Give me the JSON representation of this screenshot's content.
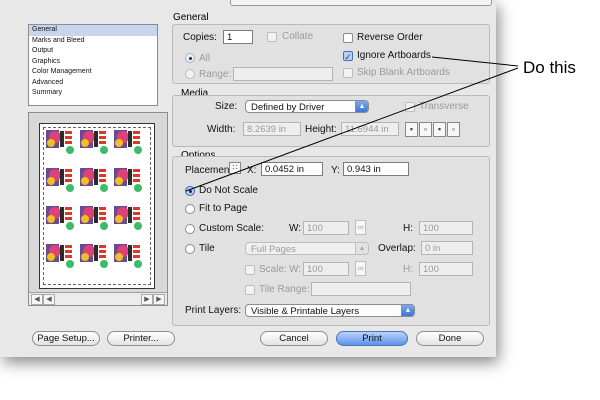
{
  "sidebar": {
    "items": [
      {
        "label": "General",
        "selected": true
      },
      {
        "label": "Marks and Bleed"
      },
      {
        "label": "Output"
      },
      {
        "label": "Graphics"
      },
      {
        "label": "Color Management"
      },
      {
        "label": "Advanced"
      },
      {
        "label": "Summary"
      }
    ]
  },
  "top_label_fragment": "",
  "general": {
    "title": "General",
    "copies_label": "Copies:",
    "copies_value": "1",
    "collate_label": "Collate",
    "all_label": "All",
    "range_label": "Range:",
    "reverse_order_label": "Reverse Order",
    "ignore_artboards_label": "Ignore Artboards",
    "skip_blank_label": "Skip Blank Artboards"
  },
  "media": {
    "title": "Media",
    "size_label": "Size:",
    "size_value": "Defined by Driver",
    "transverse_label": "Transverse",
    "width_label": "Width:",
    "width_value": "8.2639 in",
    "height_label": "Height:",
    "height_value": "11.6944 in"
  },
  "options": {
    "title": "Options",
    "placement_label": "Placement:",
    "x_label": "X:",
    "x_value": "0.0452 in",
    "y_label": "Y:",
    "y_value": "0.943 in",
    "do_not_scale": "Do Not Scale",
    "fit_to_page": "Fit to Page",
    "custom_scale": "Custom Scale:",
    "w_label": "W:",
    "w_value": "100",
    "h_label": "H:",
    "h_value": "100",
    "tile_label": "Tile",
    "tile_value": "Full Pages",
    "overlap_label": "Overlap:",
    "overlap_value": "0 in",
    "scale_label": "Scale:",
    "scale_w_label": "W:",
    "scale_w_value": "100",
    "scale_h_label": "H:",
    "scale_h_value": "100",
    "tile_range_label": "Tile Range:",
    "print_layers_label": "Print Layers:",
    "print_layers_value": "Visible & Printable Layers"
  },
  "buttons": {
    "page_setup": "Page Setup...",
    "printer": "Printer...",
    "cancel": "Cancel",
    "print": "Print",
    "done": "Done"
  },
  "annotation": {
    "text": "Do this"
  },
  "colors": {
    "accent": "#5c93e8",
    "annotation_line": "#000000"
  }
}
